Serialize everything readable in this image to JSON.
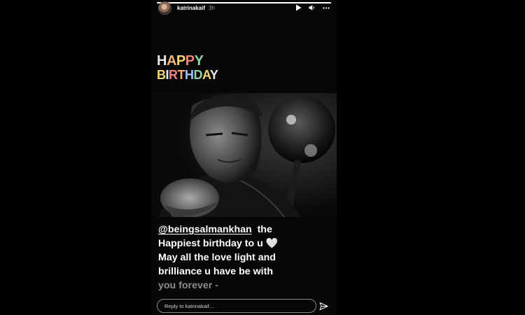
{
  "story": {
    "progress": 1.0,
    "username": "katrinakaif",
    "time": "3h"
  },
  "header_icons": [
    "play-icon",
    "volume-icon",
    "more-icon"
  ],
  "sticker": {
    "line1": "HAPPY",
    "line2": "BIRTHDAY"
  },
  "caption": {
    "mention": "@beingsalmankhan",
    "line1_rest": "the",
    "line2": "Happiest birthday to u",
    "line3": "May all the love light and",
    "line4": "brilliance u have be with",
    "line5": "you forever -"
  },
  "reply": {
    "placeholder": "Reply to katrinakaif..."
  },
  "colors": {
    "background": "#000000",
    "story_bg": "#070707",
    "text": "#ffffff"
  }
}
